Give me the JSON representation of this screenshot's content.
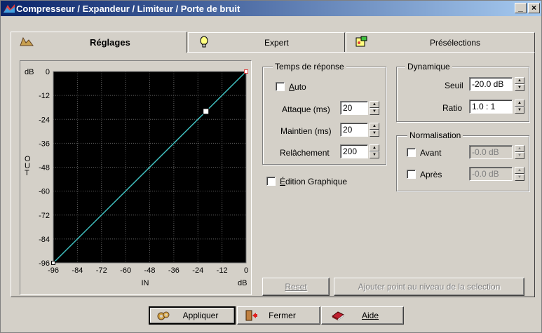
{
  "window": {
    "title": "Compresseur / Expandeur / Limiteur / Porte de bruit",
    "minimize_glyph": "_",
    "close_glyph": "×"
  },
  "tabs": [
    {
      "label": "Réglages",
      "icon": "waveform-icon",
      "active": true
    },
    {
      "label": "Expert",
      "icon": "lightbulb-icon",
      "active": false
    },
    {
      "label": "Présélections",
      "icon": "presets-icon",
      "active": false
    }
  ],
  "graph": {
    "y_label_top": "dB",
    "y_ticks": [
      "0",
      "-12",
      "-24",
      "-36",
      "-48",
      "-60",
      "-72",
      "-84",
      "-96"
    ],
    "x_ticks": [
      "-96",
      "-84",
      "-72",
      "-60",
      "-48",
      "-36",
      "-24",
      "-12",
      "0"
    ],
    "y_axis_label": "OUT",
    "x_axis_label": "IN",
    "x_unit": "dB",
    "line_color": "#40c0c0",
    "background": "#000000",
    "curve_points": [
      {
        "in": -96,
        "out": -96
      },
      {
        "in": -20,
        "out": -20
      },
      {
        "in": 0,
        "out": 0
      }
    ]
  },
  "temps_reponse": {
    "legend": "Temps de réponse",
    "auto_label": "Auto",
    "auto_underline": "A",
    "auto_checked": false,
    "attaque_label": "Attaque (ms)",
    "attaque_value": "20",
    "maintien_label": "Maintien (ms)",
    "maintien_value": "20",
    "relachement_label": "Relâchement",
    "relachement_value": "200"
  },
  "edition": {
    "label": "Édition Graphique",
    "underline": "É",
    "checked": false
  },
  "dynamique": {
    "legend": "Dynamique",
    "seuil_label": "Seuil",
    "seuil_value": "-20.0 dB",
    "ratio_label": "Ratio",
    "ratio_value": "1.0 : 1"
  },
  "normalisation": {
    "legend": "Normalisation",
    "avant_label": "Avant",
    "avant_value": "-0.0 dB",
    "apres_label": "Après",
    "apres_value": "-0.0 dB"
  },
  "panel_buttons": {
    "reset": "Reset",
    "ajouter": "Ajouter point au niveau de la selection"
  },
  "footer_buttons": {
    "appliquer": "Appliquer",
    "fermer": "Fermer",
    "aide": "Aide"
  }
}
